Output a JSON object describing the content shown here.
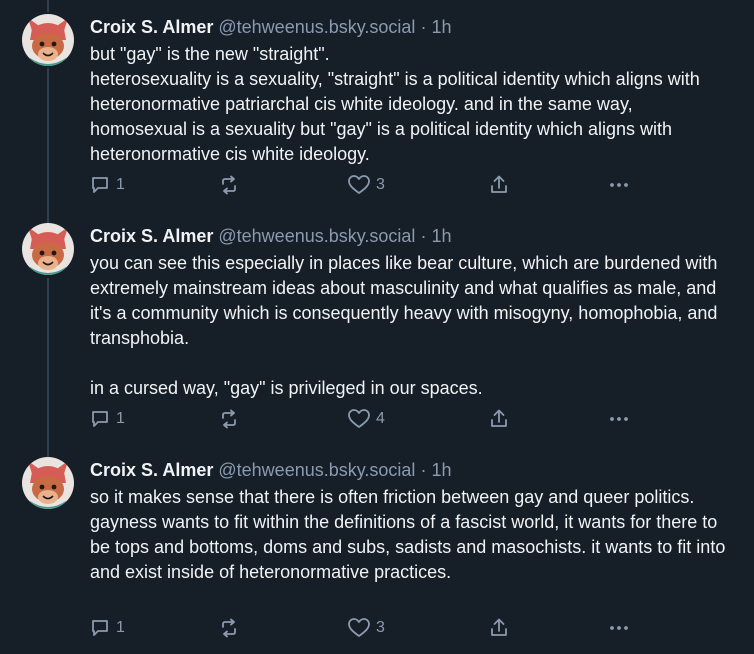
{
  "posts": [
    {
      "author_name": "Croix S. Almer",
      "handle": "@tehweenus.bsky.social",
      "separator": "·",
      "time": "1h",
      "paragraphs": [
        "but \"gay\" is the new \"straight\".",
        "heterosexuality is a sexuality, \"straight\" is a political identity which aligns with heteronormative patriarchal cis white ideology. and in the same way, homosexual is a sexuality but \"gay\" is a political identity which aligns with heteronormative cis white ideology."
      ],
      "reply_count": "1",
      "repost_count": "",
      "like_count": "3"
    },
    {
      "author_name": "Croix S. Almer",
      "handle": "@tehweenus.bsky.social",
      "separator": "·",
      "time": "1h",
      "paragraphs": [
        "you can see this especially in places like bear culture, which are burdened with extremely mainstream ideas about masculinity and what qualifies as male, and it's a community which is consequently heavy with misogyny, homophobia, and transphobia.",
        "in a cursed way, \"gay\" is privileged in our spaces."
      ],
      "reply_count": "1",
      "repost_count": "",
      "like_count": "4"
    },
    {
      "author_name": "Croix S. Almer",
      "handle": "@tehweenus.bsky.social",
      "separator": "·",
      "time": "1h",
      "paragraphs": [
        "so it makes sense that there is often friction between gay and queer politics. gayness wants to fit within the definitions of a fascist world, it wants for there to be tops and bottoms, doms and subs, sadists and masochists. it wants to fit into and exist inside of heteronormative practices."
      ],
      "reply_count": "1",
      "repost_count": "",
      "like_count": "3"
    }
  ],
  "icons": {
    "reply": "reply-icon",
    "repost": "repost-icon",
    "like": "heart-icon",
    "share": "share-icon",
    "more": "more-options-icon",
    "avatar": "avatar-cartoon-character"
  },
  "colors": {
    "background": "#161e27",
    "text": "#f1f3f5",
    "muted": "#8a9bb0",
    "thread_line": "#2e4052"
  }
}
